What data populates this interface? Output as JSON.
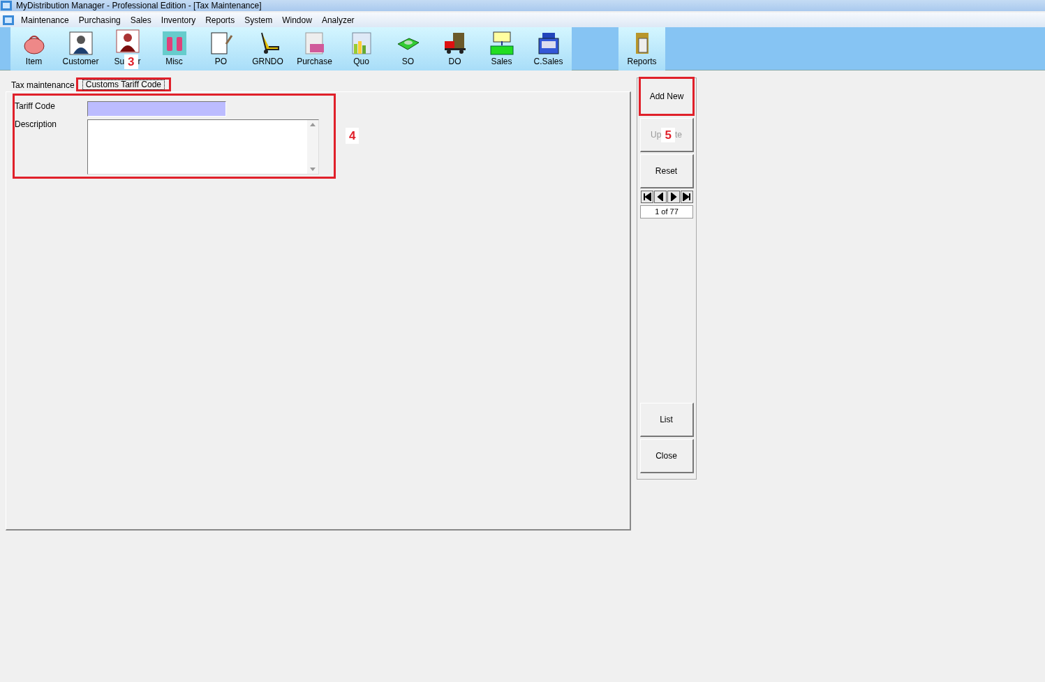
{
  "window": {
    "title": "MyDistribution Manager - Professional Edition - [Tax Maintenance]"
  },
  "menu": [
    "Maintenance",
    "Purchasing",
    "Sales",
    "Inventory",
    "Reports",
    "System",
    "Window",
    "Analyzer"
  ],
  "toolbar": [
    {
      "kind": "bag",
      "label": "Item"
    },
    {
      "kind": "person",
      "label": "Customer"
    },
    {
      "kind": "person_red",
      "label_start": "Su",
      "label_end": "r",
      "badge": "3"
    },
    {
      "kind": "earrings",
      "label": "Misc"
    },
    {
      "kind": "notepad",
      "label": "PO"
    },
    {
      "kind": "trolley",
      "label": "GRNDO"
    },
    {
      "kind": "document",
      "label": "Purchase"
    },
    {
      "kind": "chart_doc",
      "label": "Quo"
    },
    {
      "kind": "scale",
      "label": "SO"
    },
    {
      "kind": "truck",
      "label": "DO"
    },
    {
      "kind": "cash",
      "label": "Sales"
    },
    {
      "kind": "register",
      "label": "C.Sales"
    },
    {
      "kind": "gap"
    },
    {
      "kind": "book",
      "label": "Reports"
    }
  ],
  "tabs": [
    {
      "label": "Tax maintenance",
      "selected": false
    },
    {
      "label": "Customs Tariff Code",
      "selected": true
    }
  ],
  "form": {
    "fields": [
      {
        "kind": "input",
        "label": "Tariff Code"
      },
      {
        "kind": "textarea",
        "label": "Description"
      }
    ],
    "badge": "4"
  },
  "side_buttons": [
    {
      "kind": "button",
      "label": "Add New",
      "disabled": false,
      "highlighted": true
    },
    {
      "kind": "button",
      "label_start": "Up",
      "label_end": "te",
      "disabled": true,
      "badge": "5"
    },
    {
      "kind": "button",
      "label": "Reset",
      "disabled": false
    },
    {
      "kind": "nav"
    },
    {
      "kind": "spacer"
    },
    {
      "kind": "button",
      "label": "List",
      "disabled": false
    },
    {
      "kind": "button",
      "label": "Close",
      "disabled": false
    }
  ],
  "record": "1 of 77"
}
